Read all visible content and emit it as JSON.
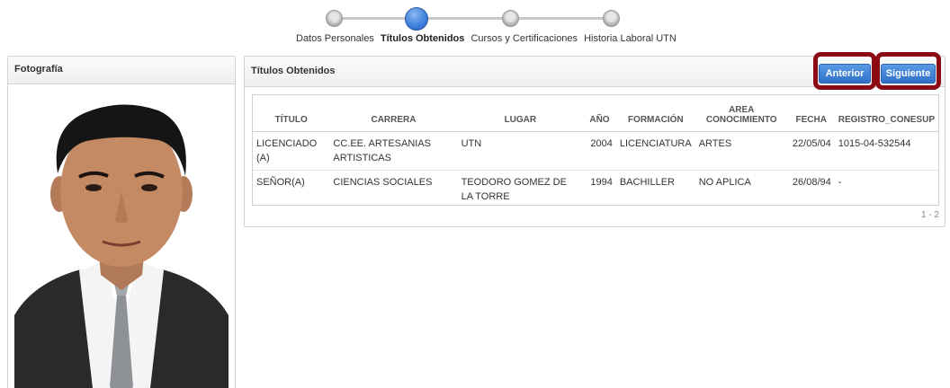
{
  "wizard": {
    "steps": [
      "Datos Personales",
      "Títulos Obtenidos",
      "Cursos y Certificaciones",
      "Historia Laboral UTN"
    ],
    "active_index": 1
  },
  "photo_panel": {
    "title": "Fotografía"
  },
  "main_panel": {
    "title": "Títulos Obtenidos",
    "prev_label": "Anterior",
    "next_label": "Siguiente"
  },
  "table": {
    "columns": [
      "TÍTULO",
      "CARRERA",
      "LUGAR",
      "AÑO",
      "FORMACIÓN",
      "AREA CONOCIMIENTO",
      "FECHA",
      "REGISTRO_CONESUP"
    ],
    "rows": [
      [
        "LICENCIADO (A)",
        "CC.EE. ARTESANIAS ARTISTICAS",
        "UTN",
        "2004",
        "LICENCIATURA",
        "ARTES",
        "22/05/04",
        "1015-04-532544"
      ],
      [
        "SEÑOR(A)",
        "CIENCIAS SOCIALES",
        "TEODORO GOMEZ DE LA TORRE",
        "1994",
        "BACHILLER",
        "NO APLICA",
        "26/08/94",
        "-"
      ]
    ],
    "pager": "1 - 2"
  },
  "colors": {
    "accent": "#3c7ddc",
    "highlight": "#8b0a14"
  }
}
